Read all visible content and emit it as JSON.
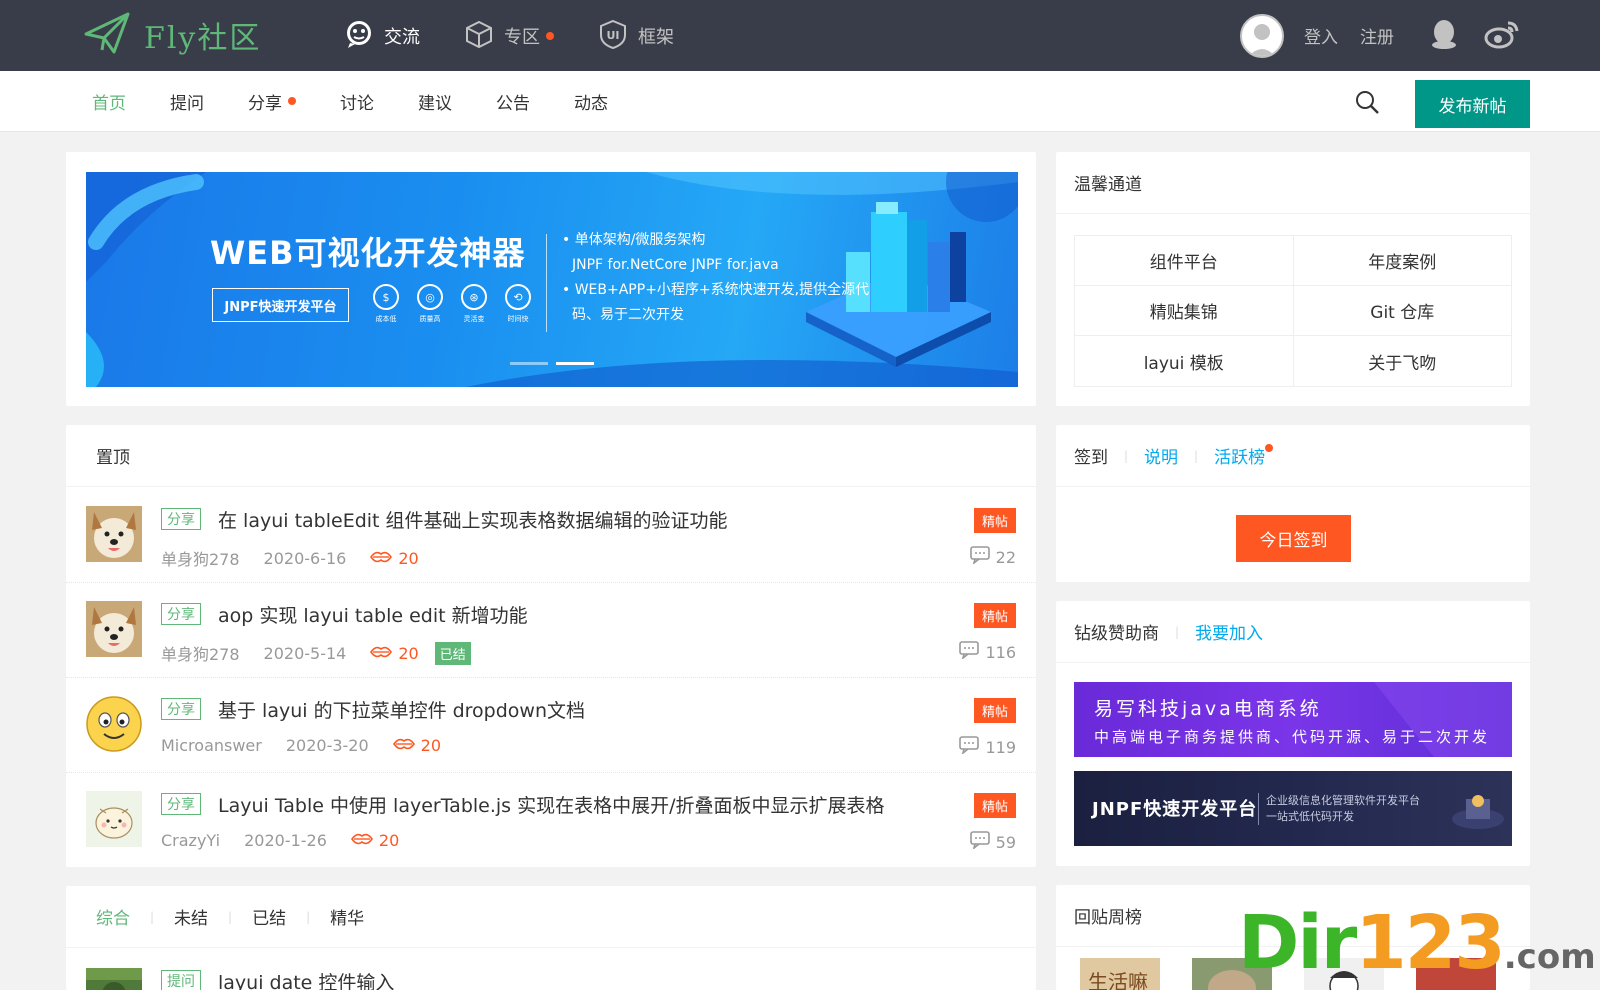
{
  "header": {
    "logo_text": "Fly社区",
    "nav": [
      {
        "label": "交流",
        "icon": "chat-icon"
      },
      {
        "label": "专区",
        "icon": "box-icon",
        "dot": true
      },
      {
        "label": "框架",
        "icon": "ui-shield-icon"
      }
    ],
    "login": "登入",
    "register": "注册",
    "icons": [
      "qq-icon",
      "weibo-icon"
    ]
  },
  "subnav": {
    "items": [
      "首页",
      "提问",
      "分享",
      "讨论",
      "建议",
      "公告",
      "动态"
    ],
    "active": "首页",
    "post_button": "发布新帖"
  },
  "banner": {
    "title": "WEB可视化开发神器",
    "button": "JNPF快速开发平台",
    "badges": [
      {
        "symbol": "$",
        "label": "成本低"
      },
      {
        "symbol": "◎",
        "label": "质量高"
      },
      {
        "symbol": "⊛",
        "label": "灵活变"
      },
      {
        "symbol": "⟲",
        "label": "时间快"
      }
    ],
    "desc": [
      "• 单体架构/微服务架构",
      "JNPF for.NetCore JNPF for.java",
      "• WEB+APP+小程序+系统快速开发,提供全源代",
      "码、易于二次开发"
    ]
  },
  "warm": {
    "title": "温馨通道",
    "rows": [
      [
        "组件平台",
        "年度案例"
      ],
      [
        "精贴集锦",
        "Git 仓库"
      ],
      [
        "layui 模板",
        "关于飞吻"
      ]
    ]
  },
  "top_posts": {
    "title": "置顶",
    "posts": [
      {
        "tag": "分享",
        "title": "在 layui tableEdit 组件基础上实现表格数据编辑的验证功能",
        "author": "单身狗278",
        "date": "2020-6-16",
        "points": "20",
        "done": "",
        "best": "精帖",
        "comments": "22"
      },
      {
        "tag": "分享",
        "title": "aop 实现 layui table edit 新增功能",
        "author": "单身狗278",
        "date": "2020-5-14",
        "points": "20",
        "done": "已结",
        "best": "精帖",
        "comments": "116"
      },
      {
        "tag": "分享",
        "title": "基于 layui 的下拉菜单控件 dropdown文档",
        "author": "Microanswer",
        "date": "2020-3-20",
        "points": "20",
        "done": "",
        "best": "精帖",
        "comments": "119"
      },
      {
        "tag": "分享",
        "title": "Layui Table 中使用 layerTable.js 实现在表格中展开/折叠面板中显示扩展表格",
        "author": "CrazyYi",
        "date": "2020-1-26",
        "points": "20",
        "done": "",
        "best": "精帖",
        "comments": "59"
      }
    ]
  },
  "filter": {
    "tabs": [
      "综合",
      "未结",
      "已结",
      "精华"
    ],
    "active": "综合",
    "first_post": {
      "tag": "提问",
      "title": "layui date 控件输入"
    }
  },
  "sign": {
    "tabs": [
      "签到",
      "说明",
      "活跃榜"
    ],
    "button": "今日签到"
  },
  "sponsor": {
    "title": "钻级赞助商",
    "join": "我要加入",
    "ad1_title": "易写科技java电商系统",
    "ad1_sub": "中高端电子商务提供商、代码开源、易于二次开发",
    "ad2_title": "JNPF快速开发平台",
    "ad2_sub1": "企业级信息化管理软件开发平台",
    "ad2_sub2": "一站式低代码开发"
  },
  "replies": {
    "title": "回贴周榜",
    "thumb1_text": "生活嘛"
  },
  "watermark": {
    "a": "Dir",
    "b": "123",
    "c": ".com"
  },
  "colors": {
    "accent": "#5fb878",
    "primary": "#009688",
    "danger": "#ff5722",
    "topbar": "#393d49",
    "link": "#01aaed"
  }
}
